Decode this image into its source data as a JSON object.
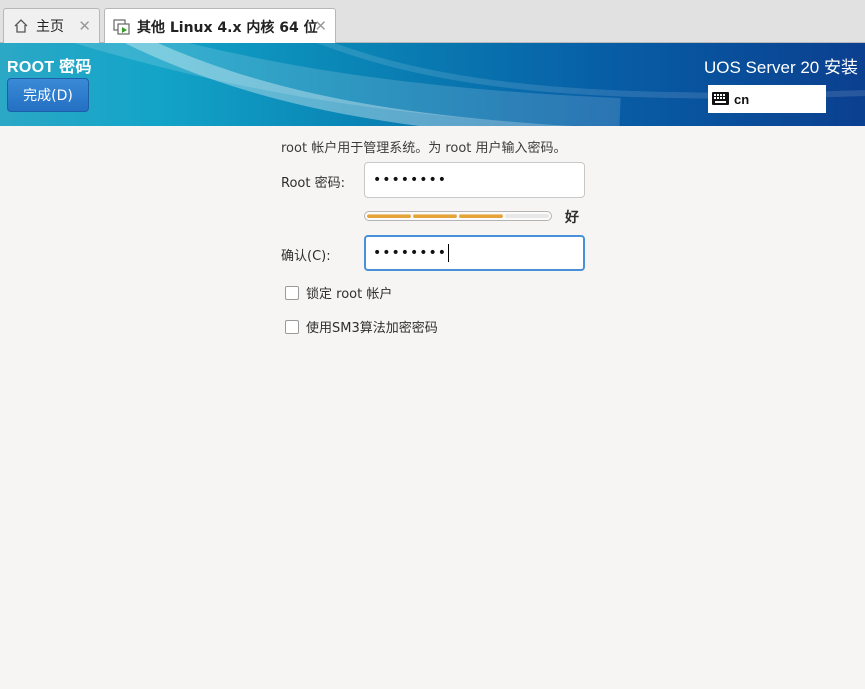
{
  "vm_tabs": [
    {
      "label": "主页",
      "icon": "home-icon"
    },
    {
      "label": "其他 Linux 4.x 内核 64 位",
      "icon": "vm-icon"
    }
  ],
  "header": {
    "spoke_title": "ROOT 密码",
    "done_label": "完成(D)",
    "product_title": "UOS Server 20 安装",
    "keyboard_layout": "cn"
  },
  "form": {
    "intro": "root 帐户用于管理系统。为 root 用户输入密码。",
    "password_label": "Root 密码:",
    "password_value": "••••••••",
    "confirm_label": "确认(C):",
    "confirm_value": "••••••••",
    "strength_level": 0.75,
    "strength_label": "好",
    "strength_color": "#e5a33a",
    "checkboxes": [
      {
        "label": "锁定 root 帐户",
        "checked": false
      },
      {
        "label": "使用SM3算法加密密码",
        "checked": false
      }
    ]
  }
}
